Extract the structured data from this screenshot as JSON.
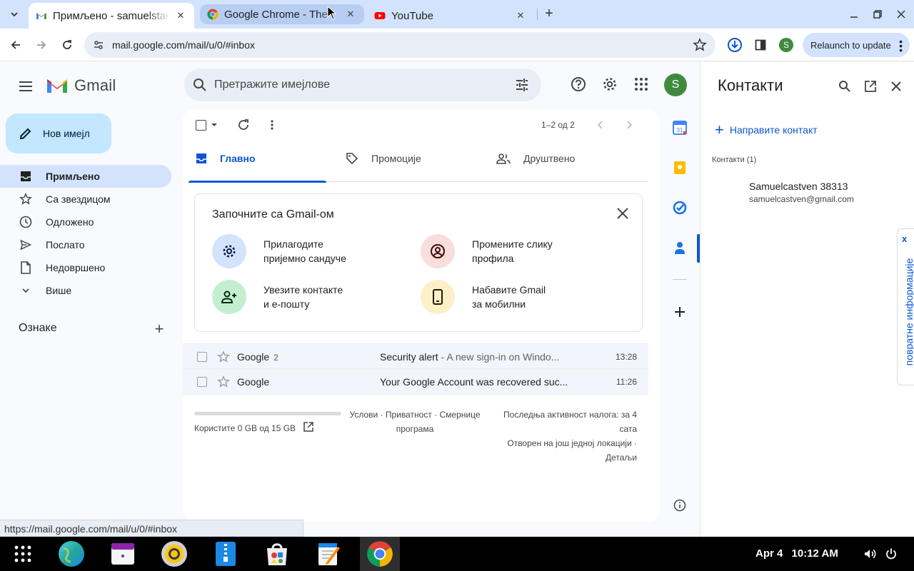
{
  "browser": {
    "tabs": [
      {
        "title": "Примљено - samuelstan",
        "favicon": "gmail-icon",
        "active": true
      },
      {
        "title": "Google Chrome - The",
        "favicon": "chrome-icon",
        "active": false
      },
      {
        "title": "YouTube",
        "favicon": "youtube-icon",
        "active": false
      }
    ],
    "url": "mail.google.com/mail/u/0/#inbox",
    "profile_initial": "S",
    "relaunch_label": "Relaunch to update"
  },
  "gmail": {
    "logo_text": "Gmail",
    "search_placeholder": "Претражите имејлове",
    "avatar_initial": "S",
    "compose_label": "Нов имејл",
    "nav": [
      {
        "label": "Примљено",
        "icon": "inbox-icon",
        "active": true
      },
      {
        "label": "Са звездицом",
        "icon": "star-icon"
      },
      {
        "label": "Одложено",
        "icon": "clock-icon"
      },
      {
        "label": "Послато",
        "icon": "send-icon"
      },
      {
        "label": "Недовршено",
        "icon": "draft-icon"
      },
      {
        "label": "Више",
        "icon": "chevron-down-icon"
      }
    ],
    "labels_header": "Ознаке",
    "pager": "1–2 од 2",
    "category_tabs": [
      {
        "label": "Главно",
        "icon": "inbox-icon",
        "active": true
      },
      {
        "label": "Промоције",
        "icon": "tag-icon"
      },
      {
        "label": "Друштвено",
        "icon": "people-icon"
      }
    ],
    "get_started": {
      "title": "Започните са Gmail-ом",
      "items": [
        {
          "line1": "Прилагодите",
          "line2": "пријемно сандуче",
          "icon": "gear-icon"
        },
        {
          "line1": "Промените слику",
          "line2": "профила",
          "icon": "account-icon"
        },
        {
          "line1": "Увезите контакте",
          "line2": "и е-пошту",
          "icon": "person-add-icon"
        },
        {
          "line1": "Набавите Gmail",
          "line2": "за мобилни",
          "icon": "phone-icon"
        }
      ]
    },
    "emails": [
      {
        "from": "Google",
        "count": "2",
        "subject": "Security alert",
        "snippet": " - A new sign-in on Windo...",
        "time": "13:28"
      },
      {
        "from": "Google",
        "count": "",
        "subject": "Your Google Account was recovered suc...",
        "snippet": "",
        "time": "11:26"
      }
    ],
    "storage_text": "Користите 0 GB од 15 GB",
    "footer_links_line1": "Услови · Приватност · Смернице",
    "footer_links_line2": "програма",
    "activity_line1": "Последња активност налога: за 4",
    "activity_line2": "сата",
    "activity_line3": "Отворен на још једној локацији ·",
    "activity_line4": "Детаљи"
  },
  "contacts": {
    "title": "Контакти",
    "create_label": "Направите контакт",
    "count_label": "Контакти (1)",
    "name": "Samuelcastven 38313",
    "email": "samuelcastven@gmail.com",
    "feedback_label": "повратне информације"
  },
  "status_url": "https://mail.google.com/mail/u/0/#inbox",
  "taskbar": {
    "date": "Apr 4",
    "time": "10:12 AM"
  },
  "colors": {
    "accent": "#0b57d0",
    "compose_bg": "#c2e7ff",
    "active_nav": "#d3e3fd",
    "avatar_green": "#3f8a3f"
  }
}
